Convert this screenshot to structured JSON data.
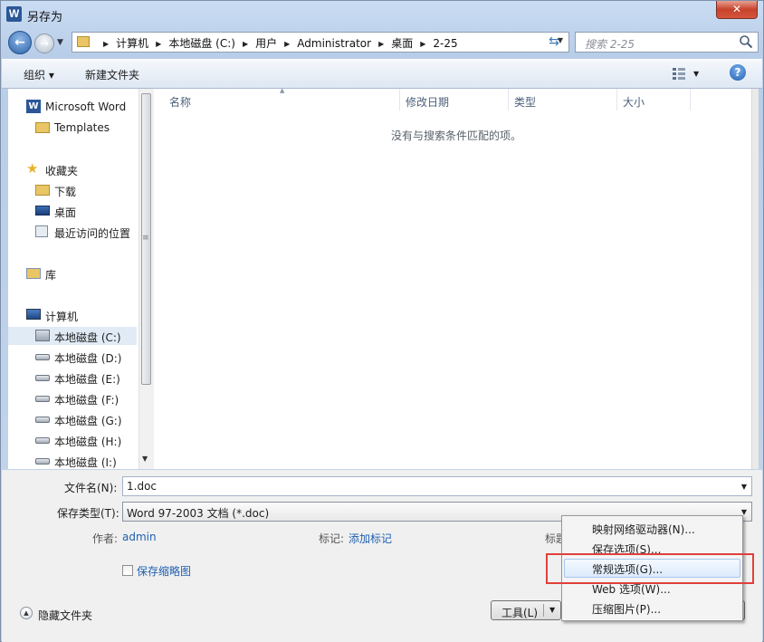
{
  "window": {
    "title": "另存为",
    "app_icon_letter": "W",
    "close_label": "✕"
  },
  "navbar": {
    "breadcrumbs": [
      "计算机",
      "本地磁盘 (C:)",
      "用户",
      "Administrator",
      "桌面",
      "2-25"
    ],
    "search_placeholder": "搜索 2-25"
  },
  "toolbar": {
    "organize_label": "组织 ▾",
    "new_folder_label": "新建文件夹",
    "help_label": "?"
  },
  "nav_pane": {
    "items": [
      {
        "label": "Microsoft Word",
        "icon": "word-icon"
      },
      {
        "label": "Templates",
        "icon": "folder-icon"
      },
      {
        "label": "收藏夹",
        "icon": "star-icon"
      },
      {
        "label": "下载",
        "icon": "downloads-folder-icon"
      },
      {
        "label": "桌面",
        "icon": "desktop-icon"
      },
      {
        "label": "最近访问的位置",
        "icon": "recent-places-icon"
      },
      {
        "label": "库",
        "icon": "library-icon"
      },
      {
        "label": "计算机",
        "icon": "computer-icon"
      },
      {
        "label": "本地磁盘 (C:)",
        "icon": "system-drive-icon"
      },
      {
        "label": "本地磁盘 (D:)",
        "icon": "drive-icon"
      },
      {
        "label": "本地磁盘 (E:)",
        "icon": "drive-icon"
      },
      {
        "label": "本地磁盘 (F:)",
        "icon": "drive-icon"
      },
      {
        "label": "本地磁盘 (G:)",
        "icon": "drive-icon"
      },
      {
        "label": "本地磁盘 (H:)",
        "icon": "drive-icon"
      },
      {
        "label": "本地磁盘 (I:)",
        "icon": "drive-icon"
      }
    ],
    "selected": "本地磁盘 (C:)"
  },
  "file_list": {
    "columns": [
      "名称",
      "修改日期",
      "类型",
      "大小"
    ],
    "empty_message": "没有与搜索条件匹配的项。"
  },
  "form": {
    "filename_label": "文件名(N):",
    "filename_value": "1.doc",
    "filetype_label": "保存类型(T):",
    "filetype_value": "Word 97-2003 文档 (*.doc)",
    "author_label": "作者:",
    "author_value": "admin",
    "tags_label": "标记:",
    "tags_value": "添加标记",
    "title_label_partial": "标题",
    "thumbnail_label": "保存缩略图",
    "thumbnail_checked": false
  },
  "footer": {
    "hide_folders_label": "隐藏文件夹",
    "tools_label": "工具(L)"
  },
  "tools_menu": {
    "items": [
      "映射网络驱动器(N)...",
      "保存选项(S)...",
      "常规选项(G)...",
      "Web 选项(W)...",
      "压缩图片(P)..."
    ],
    "highlighted": "常规选项(G)..."
  },
  "colors": {
    "highlight_box": "#e0403a",
    "link": "#2060b0",
    "accent": "#2b5797"
  }
}
